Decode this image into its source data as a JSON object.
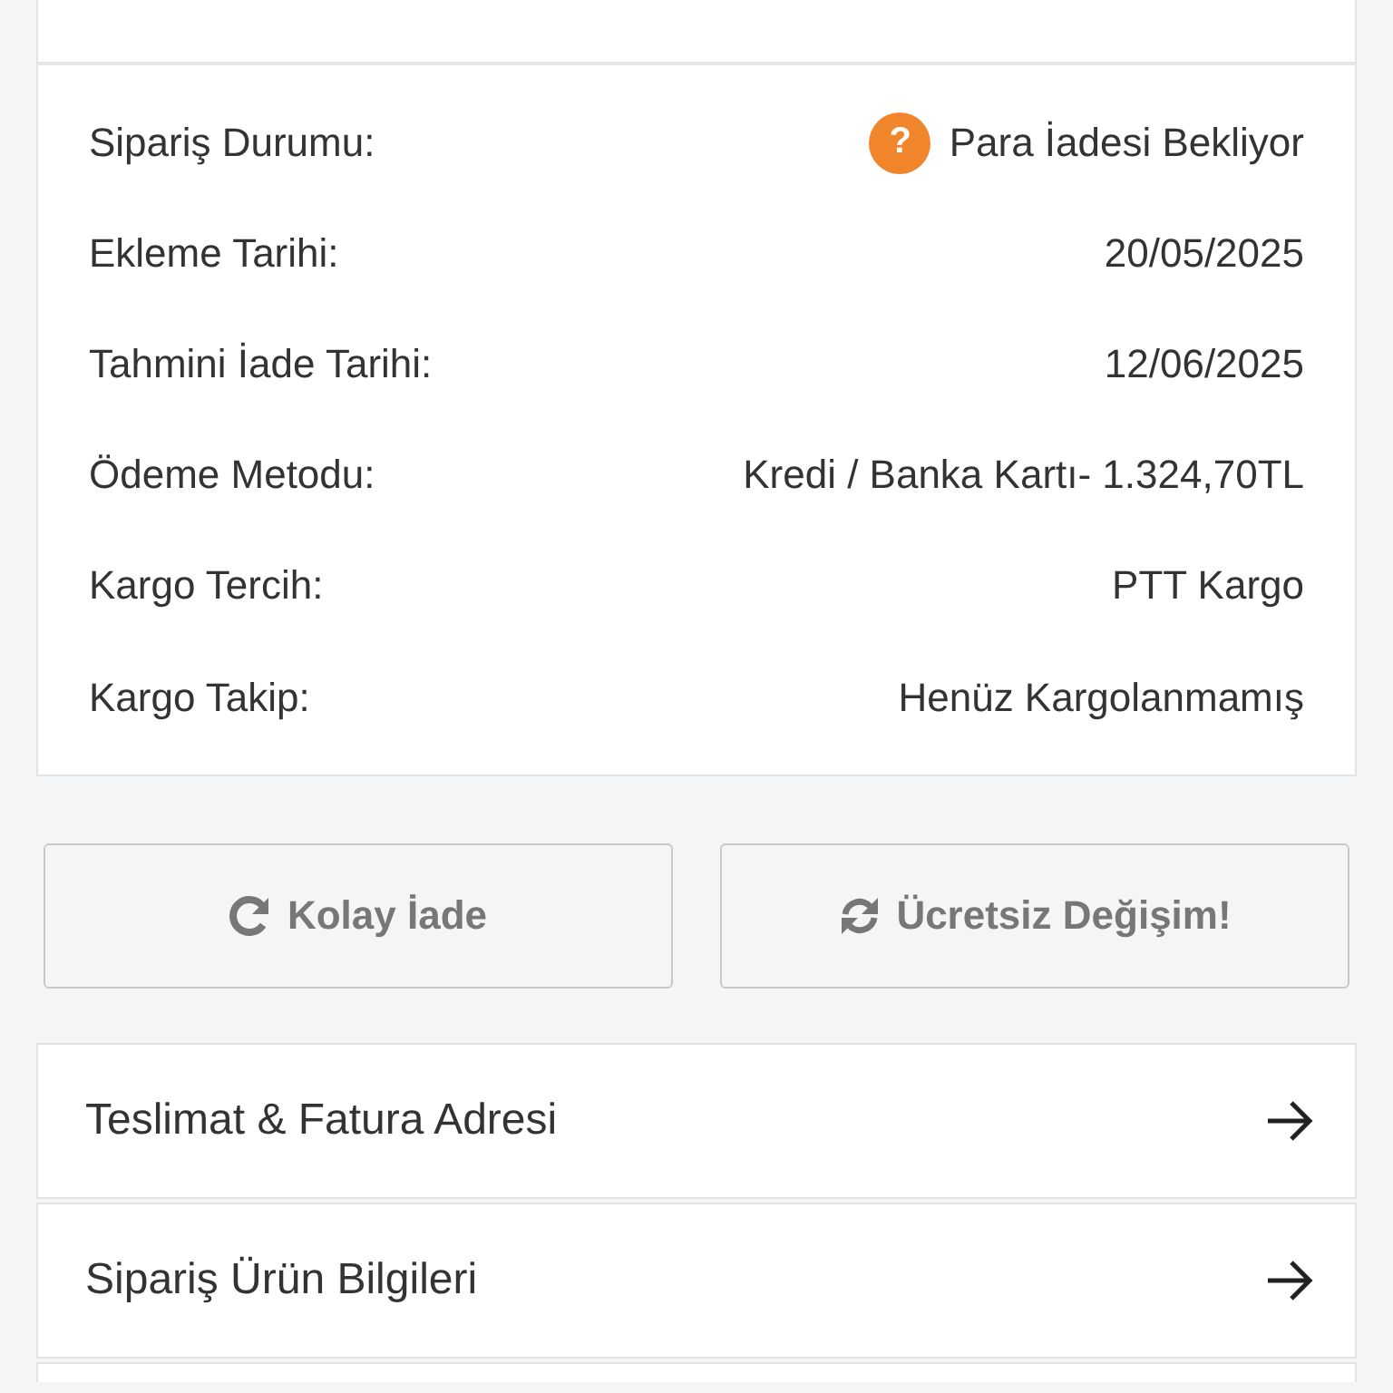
{
  "order_info": {
    "rows": [
      {
        "label": "Sipariş Durumu:",
        "value": "Para İadesi Bekliyor",
        "kind": "status",
        "status_icon": "?"
      },
      {
        "label": "Ekleme Tarihi:",
        "value": "20/05/2025",
        "kind": "text"
      },
      {
        "label": "Tahmini İade Tarihi:",
        "value": "12/06/2025",
        "kind": "text"
      },
      {
        "label": "Ödeme Metodu:",
        "value": "Kredi / Banka Kartı- 1.324,70TL",
        "kind": "text"
      },
      {
        "label": "Kargo Tercih:",
        "value": "PTT Kargo",
        "kind": "text"
      },
      {
        "label": "Kargo Takip:",
        "value": "Henüz Kargolanmamış",
        "kind": "text"
      }
    ]
  },
  "actions": [
    {
      "label": "Kolay İade",
      "kind": "return"
    },
    {
      "label": "Ücretsiz Değişim!",
      "kind": "exchange"
    }
  ],
  "links": [
    {
      "label": "Teslimat & Fatura Adresi"
    },
    {
      "label": "Sipariş Ürün Bilgileri"
    }
  ]
}
